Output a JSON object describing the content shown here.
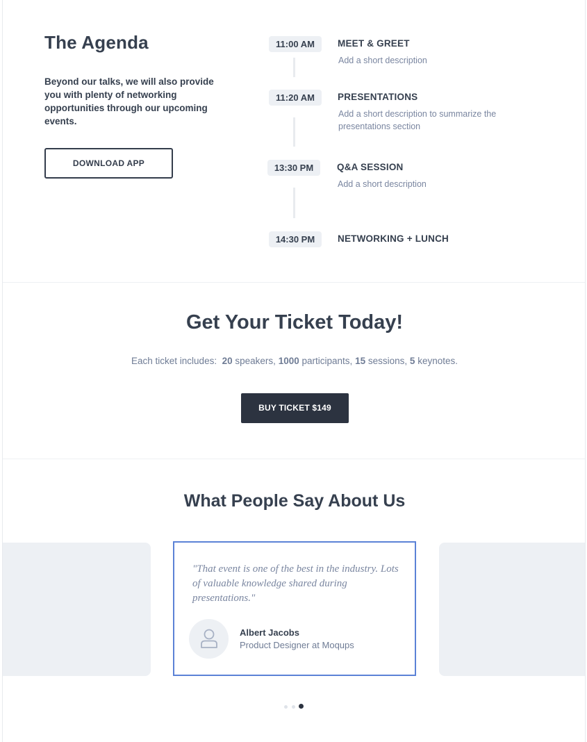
{
  "agenda": {
    "title": "The Agenda",
    "description": "Beyond our talks, we will also provide you with plenty of networking opportunities through our upcoming events.",
    "download_label": "DOWNLOAD APP",
    "events": [
      {
        "time": "11:00 AM",
        "title": "MEET & GREET",
        "description": "Add a short description"
      },
      {
        "time": "11:20 AM",
        "title": "PRESENTATIONS",
        "description": "Add a short description to summarize the presentations section"
      },
      {
        "time": "13:30 PM",
        "title": "Q&A SESSION",
        "description": "Add a short description"
      },
      {
        "time": "14:30 PM",
        "title": "NETWORKING + LUNCH",
        "description": ""
      }
    ]
  },
  "ticket": {
    "title": "Get Your Ticket Today!",
    "includes_prefix": "Each ticket includes:",
    "speakers_count": "20",
    "speakers_label": "speakers,",
    "participants_count": "1000",
    "participants_label": "participants,",
    "sessions_count": "15",
    "sessions_label": "sessions,",
    "keynotes_count": "5",
    "keynotes_label": "keynotes.",
    "buy_label": "BUY TICKET $149"
  },
  "testimonials": {
    "title": "What People Say About Us",
    "quote": "\"That event is one of the best in the industry. Lots of valuable knowledge shared during presentations.\"",
    "name": "Albert Jacobs",
    "role": "Product Designer at Moqups",
    "avatar_icon": "user-icon",
    "carousel_pages": 3,
    "carousel_active_index": 2
  },
  "colors": {
    "text_dark": "#36404f",
    "text_muted": "#7a86a0",
    "button_dark": "#2c3340",
    "card_highlight": "#5b82d6",
    "card_bg": "#edf0f4"
  }
}
